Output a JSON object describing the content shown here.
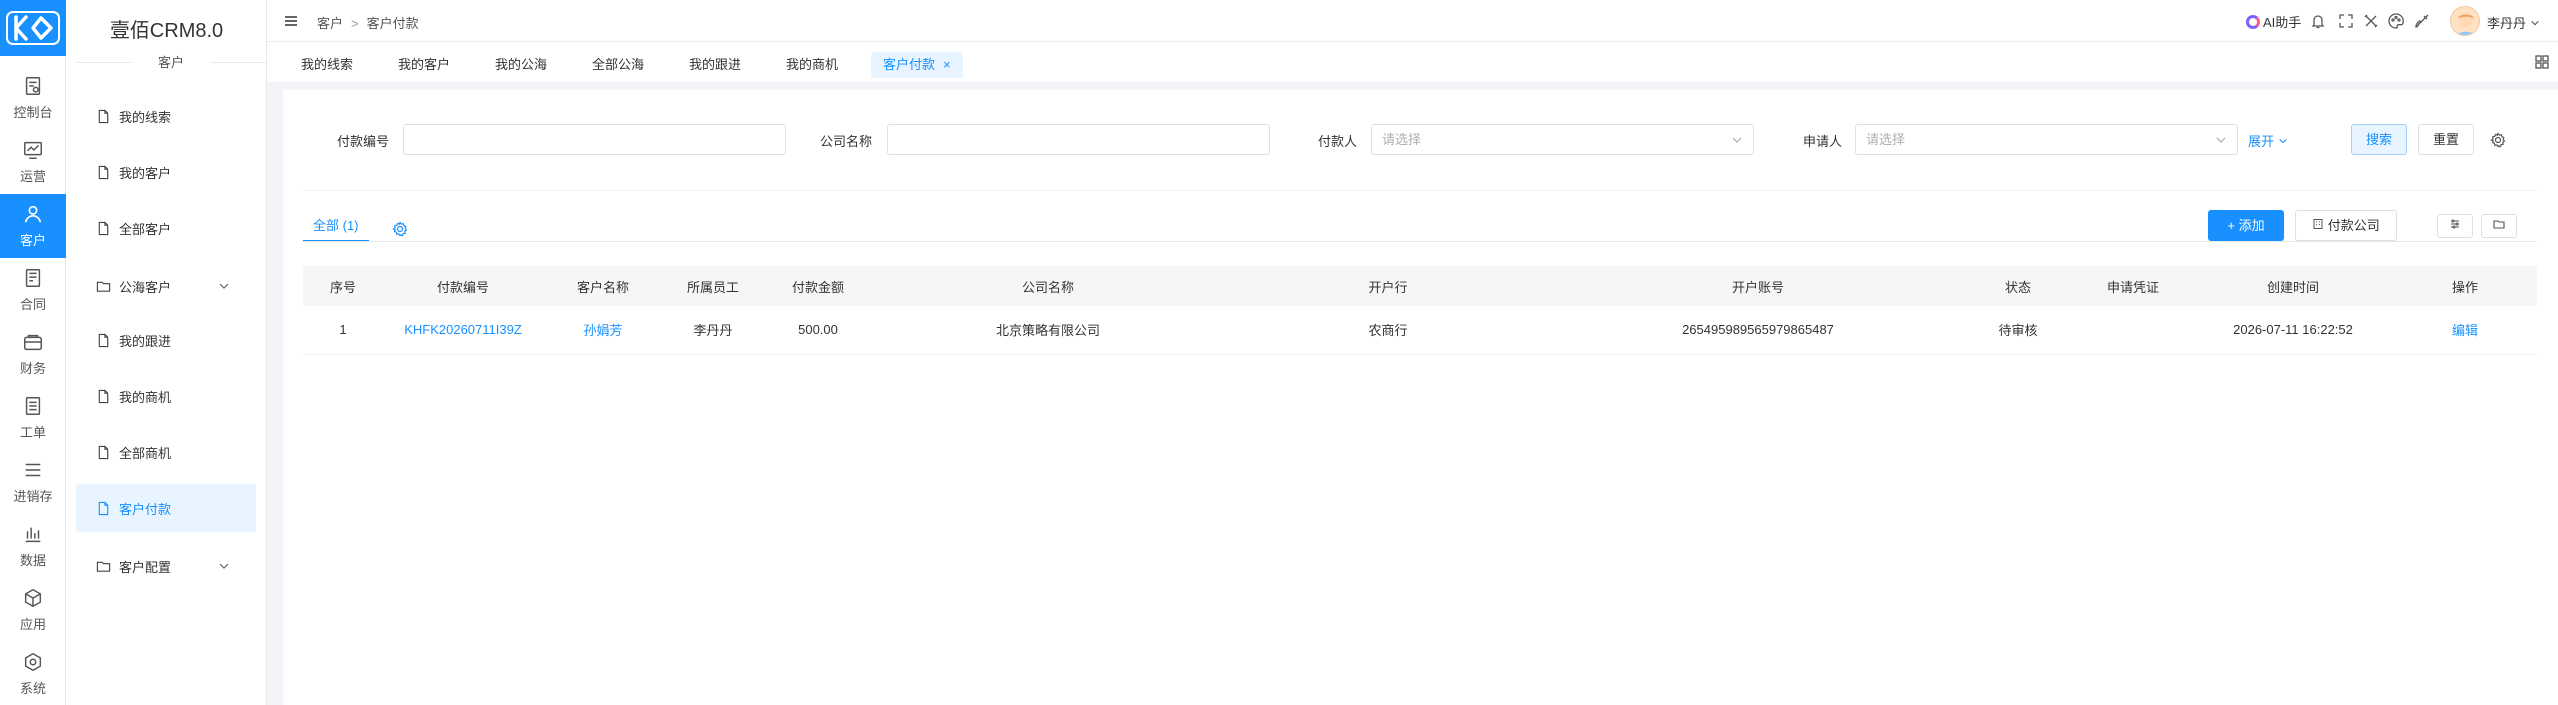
{
  "app": {
    "product_name": "壹佰CRM8.0",
    "module_label": "客户"
  },
  "rail": [
    {
      "label": "控制台",
      "icon": "dashboard-icon"
    },
    {
      "label": "运营",
      "icon": "chart-monitor-icon"
    },
    {
      "label": "客户",
      "icon": "user-icon"
    },
    {
      "label": "合同",
      "icon": "contract-icon"
    },
    {
      "label": "财务",
      "icon": "finance-icon"
    },
    {
      "label": "工单",
      "icon": "ticket-icon"
    },
    {
      "label": "进销存",
      "icon": "list-icon"
    },
    {
      "label": "数据",
      "icon": "bar-chart-icon"
    },
    {
      "label": "应用",
      "icon": "cube-icon"
    },
    {
      "label": "系统",
      "icon": "hexagon-icon"
    }
  ],
  "sidebar": {
    "items": [
      {
        "label": "我的线索"
      },
      {
        "label": "我的客户"
      },
      {
        "label": "全部客户"
      },
      {
        "label": "公海客户"
      },
      {
        "label": "我的跟进"
      },
      {
        "label": "我的商机"
      },
      {
        "label": "全部商机"
      },
      {
        "label": "客户付款"
      },
      {
        "label": "客户配置"
      }
    ]
  },
  "topbar": {
    "breadcrumb": [
      "客户",
      "客户付款"
    ],
    "breadcrumb_sep": ">",
    "ai_label": "AI助手",
    "user_name": "李丹丹"
  },
  "tabs": [
    {
      "label": "我的线索"
    },
    {
      "label": "我的客户"
    },
    {
      "label": "我的公海"
    },
    {
      "label": "全部公海"
    },
    {
      "label": "我的跟进"
    },
    {
      "label": "我的商机"
    },
    {
      "label": "客户付款",
      "close": "×"
    }
  ],
  "filters": {
    "payment_no_label": "付款编号",
    "company_label": "公司名称",
    "payer_label": "付款人",
    "payer_placeholder": "请选择",
    "applicant_label": "申请人",
    "applicant_placeholder": "请选择",
    "expand_label": "展开",
    "search_label": "搜索",
    "reset_label": "重置"
  },
  "toolbar": {
    "all_tab": "全部 (1)",
    "add_label": "添加",
    "pay_company_label": "付款公司"
  },
  "table": {
    "columns": [
      "序号",
      "付款编号",
      "客户名称",
      "所属员工",
      "付款金额",
      "公司名称",
      "开户行",
      "开户账号",
      "状态",
      "申请凭证",
      "创建时间",
      "操作"
    ],
    "rows": [
      {
        "index": "1",
        "payment_no": "KHFK20260711I39Z",
        "customer": "孙娟芳",
        "employee": "李丹丹",
        "amount": "500.00",
        "company": "北京策略有限公司",
        "bank": "农商行",
        "account": "265495989565979865487",
        "status": "待审核",
        "voucher": "",
        "created": "2026-07-11 16:22:52",
        "action": "编辑"
      }
    ]
  },
  "colors": {
    "primary": "#1890ff",
    "rail_active": "#1890ff",
    "active_bg": "#e8f4ff"
  }
}
